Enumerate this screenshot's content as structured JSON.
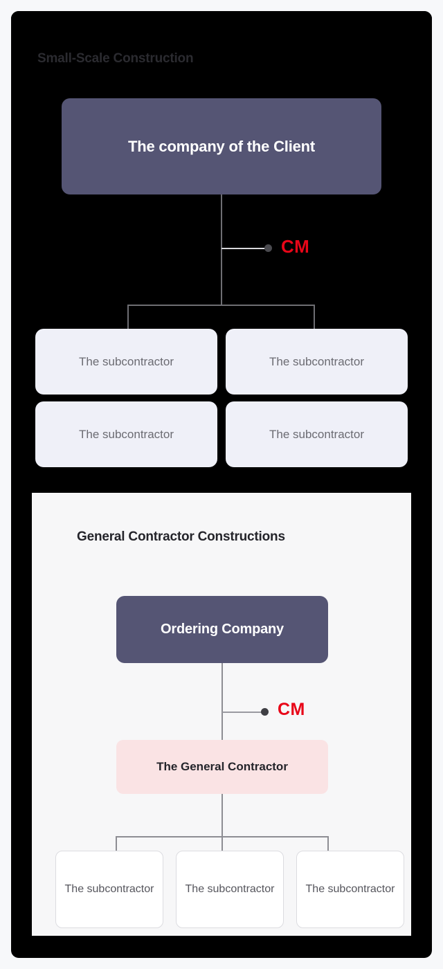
{
  "colors": {
    "frame_bg": "#000000",
    "page_bg": "#f7f8fa",
    "node_primary": "#555574",
    "node_soft": "#eff0f8",
    "node_pink": "#fae3e4",
    "accent_red": "#e80618",
    "connector_dark": "#6e6e73",
    "connector_light": "#8d8d93"
  },
  "section_dark": {
    "title": "Small-Scale Construction",
    "root": {
      "label": "The company of the Client"
    },
    "cm": {
      "label": "CM",
      "dot": "connector-dot"
    },
    "subcontractors": [
      {
        "label": "The subcontractor"
      },
      {
        "label": "The subcontractor"
      },
      {
        "label": "The subcontractor"
      },
      {
        "label": "The subcontractor"
      }
    ]
  },
  "section_light": {
    "title": "General Contractor Constructions",
    "root": {
      "label": "Ordering Company"
    },
    "cm": {
      "label": "CM",
      "dot": "connector-dot"
    },
    "contractor": {
      "label": "The General Contractor"
    },
    "subcontractors": [
      {
        "label": "The subcontractor"
      },
      {
        "label": "The subcontractor"
      },
      {
        "label": "The subcontractor"
      }
    ]
  }
}
